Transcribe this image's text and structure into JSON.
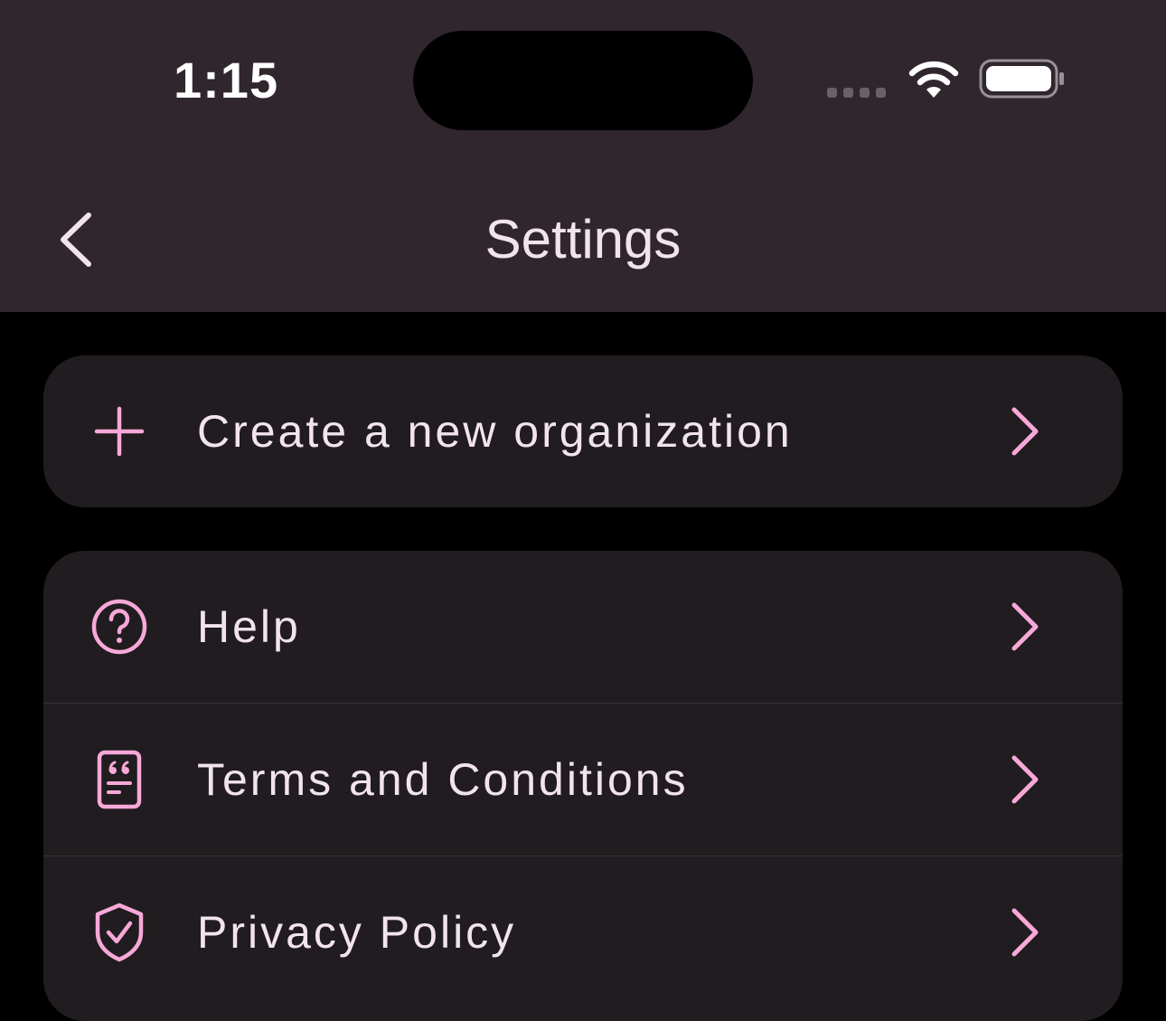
{
  "status_bar": {
    "time": "1:15",
    "icons": [
      "cellular-signal-icon",
      "wifi-icon",
      "battery-icon"
    ]
  },
  "nav": {
    "title": "Settings",
    "back_icon": "chevron-left-icon"
  },
  "create_section": {
    "items": [
      {
        "label": "Create a new organization",
        "icon": "plus-icon"
      }
    ]
  },
  "links_section": {
    "items": [
      {
        "label": "Help",
        "icon": "help-circle-icon"
      },
      {
        "label": "Terms and Conditions",
        "icon": "document-quote-icon"
      },
      {
        "label": "Privacy Policy",
        "icon": "shield-check-icon"
      }
    ]
  },
  "colors": {
    "accent": "#F7A8D8",
    "header_background": "#30262D",
    "card_background": "#201C1F",
    "page_background": "#000000",
    "text": "#F2E4EC"
  }
}
